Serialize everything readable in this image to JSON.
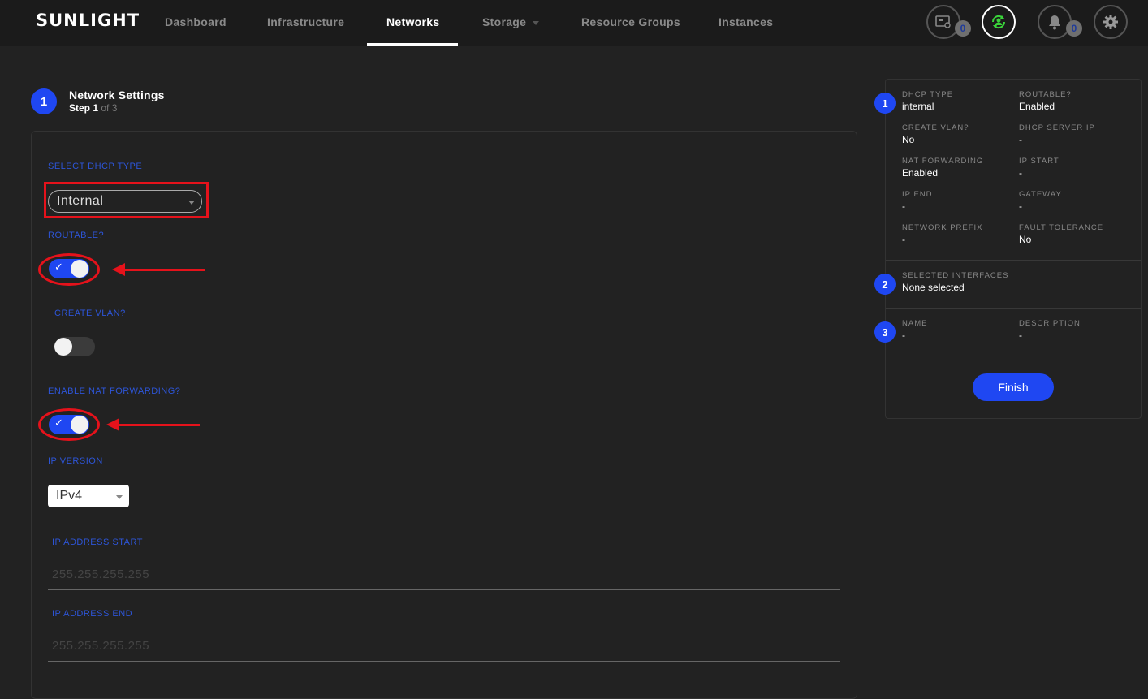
{
  "header": {
    "logo": "SUNLIGHT",
    "nav": [
      {
        "label": "Dashboard",
        "active": false
      },
      {
        "label": "Infrastructure",
        "active": false
      },
      {
        "label": "Networks",
        "active": true
      },
      {
        "label": "Storage",
        "active": false,
        "has_dropdown": true
      },
      {
        "label": "Resource Groups",
        "active": false
      },
      {
        "label": "Instances",
        "active": false
      }
    ],
    "icons": [
      {
        "name": "sim-card-icon",
        "badge": "0"
      },
      {
        "name": "user-sync-icon",
        "active": true,
        "color": "#3ad33a"
      },
      {
        "name": "bell-icon",
        "badge": "0"
      },
      {
        "name": "gear-icon"
      }
    ]
  },
  "wizard": {
    "step_number": "1",
    "title": "Network Settings",
    "step_word": "Step 1",
    "step_total": "of 3"
  },
  "form": {
    "dhcp_label": "SELECT DHCP TYPE",
    "dhcp_value": "Internal",
    "routable_label": "ROUTABLE?",
    "routable_on": true,
    "vlan_label": "CREATE VLAN?",
    "vlan_on": false,
    "nat_label": "ENABLE NAT FORWARDING?",
    "nat_on": true,
    "ipversion_label": "IP VERSION",
    "ipversion_value": "IPv4",
    "ip_start_label": "IP ADDRESS START",
    "ip_start_placeholder": "255.255.255.255",
    "ip_end_label": "IP ADDRESS END",
    "ip_end_placeholder": "255.255.255.255",
    "check_glyph": "✓"
  },
  "summary": {
    "section1": {
      "step": "1",
      "fields": [
        {
          "label": "DHCP TYPE",
          "value": "internal"
        },
        {
          "label": "ROUTABLE?",
          "value": "Enabled"
        },
        {
          "label": "CREATE VLAN?",
          "value": "No"
        },
        {
          "label": "DHCP SERVER IP",
          "value": "-"
        },
        {
          "label": "NAT FORWARDING",
          "value": "Enabled"
        },
        {
          "label": "IP START",
          "value": "-"
        },
        {
          "label": "IP END",
          "value": "-"
        },
        {
          "label": "GATEWAY",
          "value": "-"
        },
        {
          "label": "NETWORK PREFIX",
          "value": "-"
        },
        {
          "label": "FAULT TOLERANCE",
          "value": "No"
        }
      ]
    },
    "section2": {
      "step": "2",
      "label": "SELECTED INTERFACES",
      "value": "None selected"
    },
    "section3": {
      "step": "3",
      "fields": [
        {
          "label": "NAME",
          "value": "-"
        },
        {
          "label": "DESCRIPTION",
          "value": "-"
        }
      ]
    },
    "finish_label": "Finish"
  },
  "colors": {
    "accent": "#1f47f2",
    "annotation": "#e5121b",
    "label_blue": "#2d55d8"
  }
}
